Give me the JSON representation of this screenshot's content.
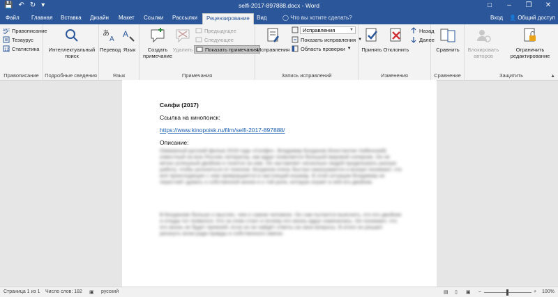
{
  "window": {
    "title": "selfi-2017-897888.docx - Word"
  },
  "tabs": [
    "Файл",
    "Главная",
    "Вставка",
    "Дизайн",
    "Макет",
    "Ссылки",
    "Рассылки",
    "Рецензирование",
    "Вид"
  ],
  "tell_me": "Что вы хотите сделать?",
  "account": {
    "signin": "Вход",
    "share": "Общий доступ"
  },
  "ribbon": {
    "proofing": {
      "spelling": "Правописание",
      "thesaurus": "Тезаурус",
      "stats": "Статистика",
      "label": "Правописание"
    },
    "insights": {
      "smart_lookup_1": "Интеллектуальный",
      "smart_lookup_2": "поиск",
      "label": "Подробные сведения"
    },
    "language": {
      "translate": "Перевод",
      "language": "Язык",
      "label": "Язык"
    },
    "comments": {
      "new_1": "Создать",
      "new_2": "примечание",
      "delete": "Удалить",
      "previous": "Предыдущее",
      "next": "Следующее",
      "show": "Показать примечания",
      "label": "Примечания"
    },
    "tracking": {
      "track": "Исправления",
      "markup": "Исправления",
      "show_markup": "Показать исправления",
      "review_pane": "Область проверки",
      "label": "Запись исправлений"
    },
    "changes": {
      "accept": "Принять",
      "reject": "Отклонить",
      "previous": "Назад",
      "next": "Далее",
      "label": "Изменения"
    },
    "compare": {
      "compare": "Сравнить",
      "label": "Сравнение"
    },
    "protect": {
      "block_1": "Блокировать",
      "block_2": "авторов",
      "restrict_1": "Ограничить",
      "restrict_2": "редактирование",
      "label": "Защитить"
    }
  },
  "document": {
    "title": "Селфи (2017)",
    "link_label": "Ссылка на кинопоиск:",
    "url": "https://www.kinopoisk.ru/film/selfi-2017-897888/",
    "desc_label": "Описание:",
    "para1": "Оммажный русский фильм 2018 года «Селфи». Владимир Богданов (Константин Хабенский) известный на всю Россию литератор, как вдруг появляется большой мировой соперник. Он не вечно успешный двойник и гонится за ним. Он заставляет несколько людей проделывать разную работу, чтобы уклониться от поисков. Богданов очень быстро наказывается и вскоре понимает, что всё происходящее с ним превращается в настоящий кошмар. В этой ситуации Владимир не перестаёт думать о собственной жизни и о той роли, которую играет в ней его двойник.",
    "para2": "В Богданове больше о мыслях, чем о самом человеке. Он сам пытается выяснить, кто его двойник и откуда тот появился. Кто за этим стоит и почему его жизнь вдруг изменилась. Он понимает, что его жизнь не будет прежней, если он не найдёт ответы на свои вопросы. В итоге он решает рискнуть всем ради правды и собственного имени."
  },
  "status": {
    "page": "Страница 1 из 1",
    "words": "Число слов: 182",
    "lang": "русский",
    "zoom": "100%"
  }
}
